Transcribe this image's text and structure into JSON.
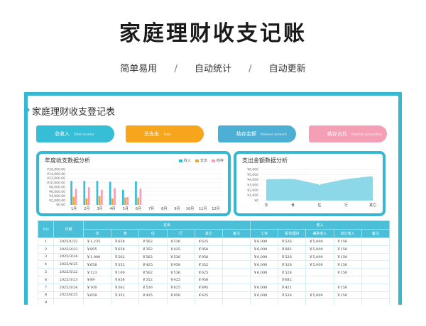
{
  "hero": {
    "title": "家庭理财收支记账",
    "subtitles": [
      "简单易用",
      "自动统计",
      "自动更新"
    ],
    "separator": "/"
  },
  "sheet": {
    "title": "家庭理财收支登记表"
  },
  "cards": [
    {
      "label": "总收入",
      "en": "Total income",
      "color": "#36bed6"
    },
    {
      "label": "总支出",
      "en": "Total",
      "color": "#f7a51c"
    },
    {
      "label": "结存金额",
      "en": "Balance amount",
      "color": "#4dafd3"
    },
    {
      "label": "结存占比",
      "en": "Balance proportion",
      "color": "#f59fb7"
    }
  ],
  "chart_data": [
    {
      "type": "bar",
      "title": "年度收支数据分析",
      "categories": [
        "1月",
        "2月",
        "3月",
        "4月",
        "5月",
        "6月",
        "7月",
        "8月",
        "9月",
        "10月",
        "11月",
        "12月"
      ],
      "series": [
        {
          "name": "收入",
          "color": "#36bed6",
          "values": [
            10800,
            10800,
            10800,
            10400,
            6800,
            10600,
            0,
            0,
            0,
            0,
            0,
            0
          ]
        },
        {
          "name": "支出",
          "color": "#f7a51c",
          "values": [
            3600,
            2900,
            4000,
            2900,
            3300,
            3300,
            0,
            0,
            0,
            0,
            0,
            0
          ]
        },
        {
          "name": "结存",
          "color": "#f59fb7",
          "values": [
            7200,
            7900,
            6800,
            7500,
            3500,
            7300,
            0,
            0,
            0,
            0,
            0,
            0
          ]
        }
      ],
      "ylim": [
        0,
        16000
      ],
      "yticks": [
        "¥0.00",
        "¥2,000.00",
        "¥4,000.00",
        "¥6,000.00",
        "¥8,000.00",
        "¥10,000.00",
        "¥12,000.00",
        "¥14,000.00",
        "¥16,000.00"
      ]
    },
    {
      "type": "area",
      "title": "支出金额数据分析",
      "categories": [
        "衣",
        "食",
        "住",
        "行",
        "其它"
      ],
      "series": [
        {
          "color": "#7fd4e6",
          "values": [
            4100,
            4200,
            3100,
            4150,
            4700
          ]
        }
      ],
      "ylim": [
        0,
        6000
      ],
      "yticks": [
        "¥0",
        "¥1,000",
        "¥2,000",
        "¥3,000",
        "¥4,000",
        "¥5,000",
        "¥6,000"
      ]
    }
  ],
  "table": {
    "group_headers": [
      "NO",
      "日期",
      "支出",
      "收入"
    ],
    "sub_headers": [
      "衣",
      "食",
      "住",
      "行",
      "其它",
      "备注",
      "工资",
      "投资理财",
      "兼职收入",
      "其它收入",
      "备注"
    ],
    "rows": [
      [
        "1",
        "2025/1/22",
        "￥1,235",
        "￥658",
        "￥562",
        "￥536",
        "￥625",
        "",
        "￥6,000",
        "￥526",
        "￥5,000",
        "￥150",
        ""
      ],
      [
        "2",
        "2025/2/23",
        "￥895",
        "￥658",
        "￥352",
        "￥425",
        "￥958",
        "",
        "￥6,000",
        "￥682",
        "￥5,000",
        "￥150",
        ""
      ],
      [
        "3",
        "2025/3/24",
        "￥1,000",
        "￥562",
        "￥562",
        "￥536",
        "￥958",
        "",
        "￥6,000",
        "￥526",
        "￥5,000",
        "￥150",
        ""
      ],
      [
        "4",
        "2025/4/25",
        "￥658",
        "￥352",
        "￥425",
        "￥958",
        "￥352",
        "",
        "￥6,000",
        "￥328",
        "￥5,000",
        "￥150",
        ""
      ],
      [
        "5",
        "2025/5/22",
        "￥123",
        "￥100",
        "￥562",
        "￥536",
        "￥625",
        "",
        "￥6,000",
        "￥528",
        "",
        "￥150",
        ""
      ],
      [
        "6",
        "2025/3/23",
        "￥89",
        "￥658",
        "￥352",
        "￥425",
        "￥958",
        "",
        "",
        "￥682",
        "",
        "",
        ""
      ],
      [
        "7",
        "2025/3/24",
        "￥100",
        "￥562",
        "￥536",
        "￥625",
        "￥895",
        "",
        "￥6,000",
        "￥421",
        "",
        "￥150",
        ""
      ],
      [
        "8",
        "2025/6/25",
        "￥658",
        "￥352",
        "￥425",
        "￥958",
        "￥625",
        "",
        "￥6,000",
        "￥526",
        "￥5,000",
        "￥150",
        ""
      ],
      [
        "9",
        "",
        "",
        "",
        "",
        "",
        "",
        "",
        "",
        "",
        "",
        "",
        ""
      ]
    ]
  }
}
